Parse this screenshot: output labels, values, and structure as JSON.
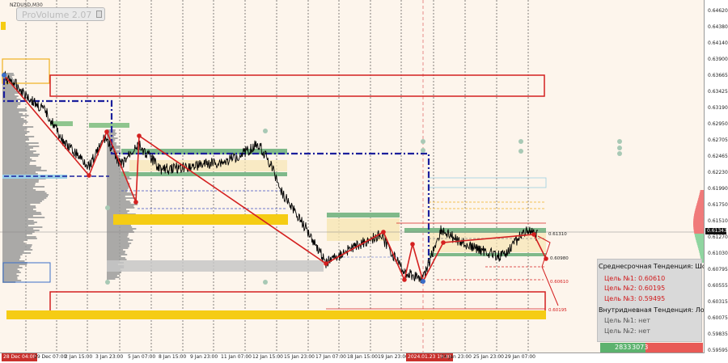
{
  "chart": {
    "symbol": "NZDUSD,M30",
    "indicator_label": "ProVolume 2.07",
    "current_price": "0.61343"
  },
  "price_axis": [
    "0.64620",
    "0.64380",
    "0.64140",
    "0.63900",
    "0.63665",
    "0.63425",
    "0.63190",
    "0.62950",
    "0.62705",
    "0.62465",
    "0.62230",
    "0.61990",
    "0.61750",
    "0.61510",
    "0.61270",
    "0.61030",
    "0.60795",
    "0.60555",
    "0.60315",
    "0.60075",
    "0.59835",
    "0.59595"
  ],
  "time_axis": [
    "28 Dec 04:00",
    "29 Dec 07:00",
    "2 Jan 15:00",
    "3 Jan 23:00",
    "5 Jan 07:00",
    "8 Jan 15:00",
    "9 Jan 23:00",
    "11 Jan 07:00",
    "12 Jan 15:00",
    "15 Jan 23:00",
    "17 Jan 07:00",
    "18 Jan 15:00",
    "19 Jan 23:00",
    "2024.01.23 19:30",
    "24 Jan 23:00",
    "25 Jan 23:00",
    "29 Jan 07:00"
  ],
  "level_labels": {
    "upper": "0.61310",
    "mid": "0.60980",
    "low1": "0.60610",
    "low2": "0.60195"
  },
  "info_panel": {
    "medium_term_title": "Среднесрочная Тенденция: Шорт",
    "target1": "Цель №1: 0.60610",
    "target2": "Цель №2: 0.60195",
    "target3": "Цель №3: 0.59495",
    "intraday_title": "Внутридневная Тенденция: Лонг",
    "intraday_target1": "Цель №1: нет",
    "intraday_target2": "Цель №2: нет"
  },
  "volume": {
    "buy": "2833",
    "sell": "3073",
    "buy_color": "#5cb26e",
    "sell_color": "#e85a56"
  },
  "colors": {
    "background": "#fdf5ec",
    "zigzag": "#d42020",
    "price_line": "#000000",
    "dash_blue": "#1b1f9c",
    "yellow_zone": "#f5cc14",
    "green_zone": "#7fb98a",
    "profile_gray": "#9b9b9b"
  }
}
